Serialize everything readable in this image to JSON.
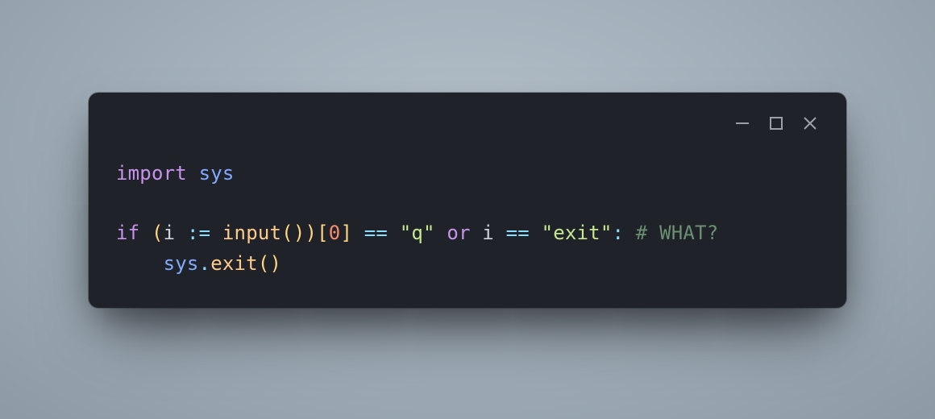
{
  "window": {
    "controls": {
      "minimize": "minimize-icon",
      "maximize": "maximize-icon",
      "close": "close-icon"
    }
  },
  "code": {
    "line1": {
      "kw_import": "import",
      "module": "sys"
    },
    "line2": "",
    "line3": {
      "kw_if": "if",
      "lparen1": "(",
      "ident_i": "i",
      "walrus": ":=",
      "func_input": "input",
      "lparen2": "(",
      "rparen2": ")",
      "rparen1": ")",
      "lbracket": "[",
      "num_zero": "0",
      "rbracket": "]",
      "eq1": "==",
      "str_q": "\"q\"",
      "kw_or": "or",
      "ident_i2": "i",
      "eq2": "==",
      "str_exit": "\"exit\"",
      "colon": ":",
      "comment": "# WHAT?"
    },
    "line4": {
      "indent": "    ",
      "module": "sys",
      "dot": ".",
      "func_exit": "exit",
      "lparen": "(",
      "rparen": ")"
    }
  }
}
